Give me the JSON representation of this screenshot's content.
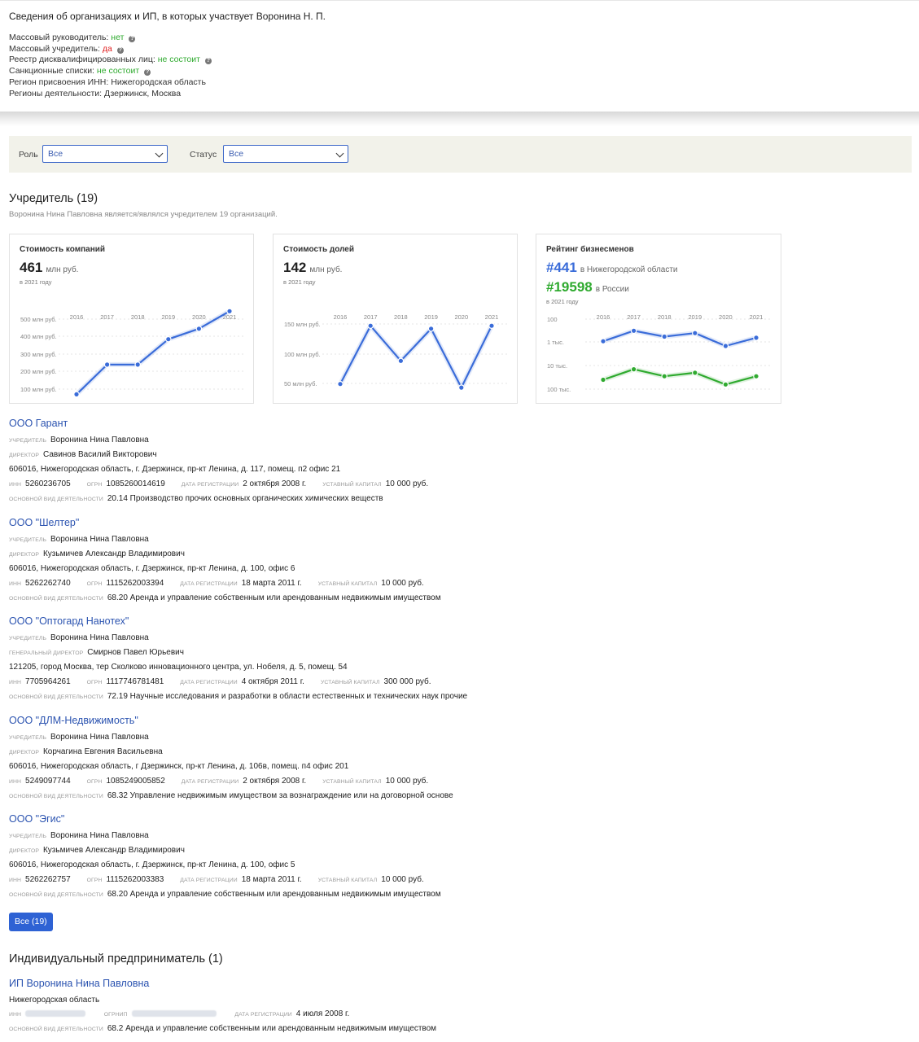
{
  "header": {
    "title": "Сведения об организациях и ИП, в которых участвует Воронина Н. П.",
    "lines": [
      {
        "label": "Массовый руководитель: ",
        "value": "нет",
        "tone": "ok",
        "help": true
      },
      {
        "label": "Массовый учредитель: ",
        "value": "да",
        "tone": "bad",
        "help": true
      },
      {
        "label": "Реестр дисквалифицированных лиц: ",
        "value": "не состоит",
        "tone": "ok",
        "help": true
      },
      {
        "label": "Санкционные списки: ",
        "value": "не состоит",
        "tone": "ok",
        "help": true
      },
      {
        "label": "Регион присвоения ИНН: ",
        "value": "Нижегородская область",
        "tone": "",
        "help": false
      },
      {
        "label": "Регионы деятельности: ",
        "value": "Дзержинск, Москва",
        "tone": "",
        "help": false
      }
    ]
  },
  "filters": {
    "role_label": "Роль",
    "role_value": "Все",
    "status_label": "Статус",
    "status_value": "Все"
  },
  "founder": {
    "title": "Учредитель (19)",
    "subtitle": "Воронина Нина Павловна является/являлся учредителем 19 организаций."
  },
  "cards": {
    "company_value": {
      "title": "Стоимость компаний",
      "value": "461",
      "unit": "млн руб.",
      "note": "в 2021 году"
    },
    "share_value": {
      "title": "Стоимость долей",
      "value": "142",
      "unit": "млн руб.",
      "note": "в 2021 году"
    },
    "rating": {
      "title": "Рейтинг бизнесменов",
      "region_rank": "#441",
      "region_label": "в Нижегородской области",
      "country_rank": "#19598",
      "country_label": "в России",
      "note": "в 2021 году"
    }
  },
  "chart_data": [
    {
      "type": "line",
      "x": [
        "2016",
        "2017",
        "2018",
        "2019",
        "2020",
        "2021"
      ],
      "yticks": [
        "500 млн руб.",
        "400 млн руб.",
        "300 млн руб.",
        "200 млн руб.",
        "100 млн руб."
      ],
      "ytick_values": [
        500,
        400,
        300,
        200,
        100
      ],
      "ylim": [
        50,
        550
      ],
      "series": [
        {
          "values": [
            70,
            240,
            240,
            385,
            445,
            545
          ],
          "color": "#3a6cd9"
        }
      ]
    },
    {
      "type": "line",
      "x": [
        "2016",
        "2017",
        "2018",
        "2019",
        "2020",
        "2021"
      ],
      "yticks": [
        "150 млн руб.",
        "100 млн руб.",
        "50 млн руб."
      ],
      "ytick_values": [
        150,
        100,
        50
      ],
      "ylim": [
        35,
        165
      ],
      "series": [
        {
          "values": [
            49,
            147,
            88,
            142,
            43,
            147
          ],
          "color": "#3a6cd9"
        }
      ]
    },
    {
      "type": "line",
      "x": [
        "2016",
        "2017",
        "2018",
        "2019",
        "2020",
        "2021"
      ],
      "yticks": [
        "100",
        "1 тыс.",
        "10 тыс.",
        "100 тыс."
      ],
      "ytick_values": [
        0,
        1,
        2,
        3
      ],
      "ylim": [
        0,
        3
      ],
      "inverted": true,
      "series": [
        {
          "values": [
            0.95,
            0.5,
            0.75,
            0.6,
            1.15,
            0.8
          ],
          "color": "#3a6cd9"
        },
        {
          "values": [
            2.6,
            2.15,
            2.45,
            2.3,
            2.8,
            2.45
          ],
          "color": "#2faa2f"
        }
      ]
    }
  ],
  "labels": {
    "founder": "учредитель",
    "director": "директор",
    "general_director": "генеральный директор",
    "inn": "инн",
    "ogrn": "огрн",
    "ogrnip": "огрнип",
    "reg_date": "дата регистрации",
    "capital": "уставный капитал",
    "activity": "основной вид деятельности"
  },
  "orgs": [
    {
      "name": "ООО Гарант",
      "founder": "Воронина Нина Павловна",
      "director_label": "директор",
      "director": "Савинов Василий Викторович",
      "address": "606016, Нижегородская область, г. Дзержинск, пр-кт Ленина, д. 117, помещ. п2 офис 21",
      "inn": "5260236705",
      "ogrn": "1085260014619",
      "reg_date": "2 октября 2008 г.",
      "capital": "10 000 руб.",
      "activity": "20.14 Производство прочих основных органических химических веществ"
    },
    {
      "name": "ООО \"Шелтер\"",
      "founder": "Воронина Нина Павловна",
      "director_label": "директор",
      "director": "Кузьмичев Александр Владимирович",
      "address": "606016, Нижегородская область, г. Дзержинск, пр-кт Ленина, д. 100, офис 6",
      "inn": "5262262740",
      "ogrn": "1115262003394",
      "reg_date": "18 марта 2011 г.",
      "capital": "10 000 руб.",
      "activity": "68.20 Аренда и управление собственным или арендованным недвижимым имуществом"
    },
    {
      "name": "ООО \"Оптогард Нанотех\"",
      "founder": "Воронина Нина Павловна",
      "director_label": "генеральный директор",
      "director": "Смирнов Павел Юрьевич",
      "address": "121205, город Москва, тер Сколково инновационного центра, ул. Нобеля, д. 5, помещ. 54",
      "inn": "7705964261",
      "ogrn": "1117746781481",
      "reg_date": "4 октября 2011 г.",
      "capital": "300 000 руб.",
      "activity": "72.19 Научные исследования и разработки в области естественных и технических наук прочие"
    },
    {
      "name": "ООО \"ДЛМ-Недвижимость\"",
      "founder": "Воронина Нина Павловна",
      "director_label": "директор",
      "director": "Корчагина Евгения Васильевна",
      "address": "606016, Нижегородская область, г Дзержинск, пр-кт Ленина, д. 106в, помещ. п4 офис 201",
      "inn": "5249097744",
      "ogrn": "1085249005852",
      "reg_date": "2 октября 2008 г.",
      "capital": "10 000 руб.",
      "activity": "68.32 Управление недвижимым имуществом за вознаграждение или на договорной основе"
    },
    {
      "name": "ООО \"Эгис\"",
      "founder": "Воронина Нина Павловна",
      "director_label": "директор",
      "director": "Кузьмичев Александр Владимирович",
      "address": "606016, Нижегородская область, г. Дзержинск, пр-кт Ленина, д. 100, офис 5",
      "inn": "5262262757",
      "ogrn": "1115262003383",
      "reg_date": "18 марта 2011 г.",
      "capital": "10 000 руб.",
      "activity": "68.20 Аренда и управление собственным или арендованным недвижимым имуществом"
    }
  ],
  "all_button": "Все (19)",
  "ip": {
    "title": "Индивидуальный предприниматель (1)",
    "name": "ИП Воронина Нина Павловна",
    "region": "Нижегородская область",
    "reg_date": "4 июля 2008 г.",
    "activity": "68.2 Аренда и управление собственным или арендованным недвижимым имуществом"
  }
}
